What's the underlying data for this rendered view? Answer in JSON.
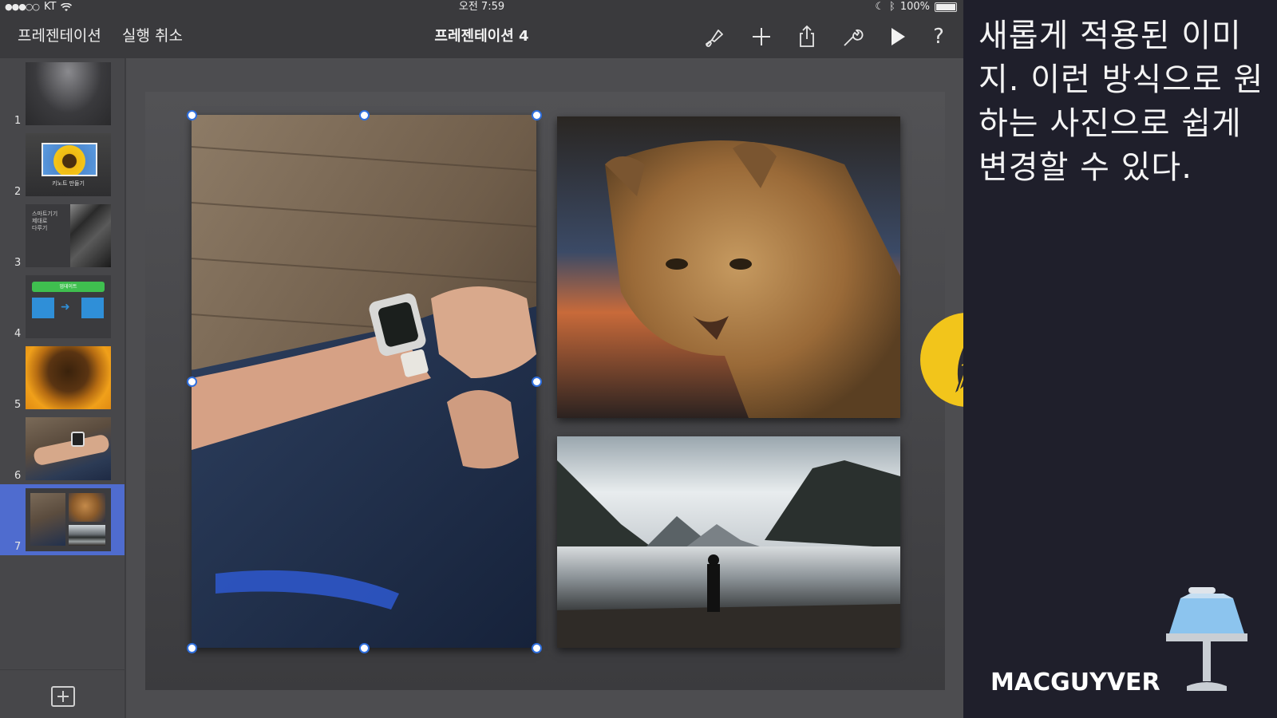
{
  "status_bar": {
    "carrier": "KT",
    "time": "오전 7:59",
    "battery": "100%"
  },
  "toolbar": {
    "presentations_label": "프레젠테이션",
    "undo_label": "실행 취소",
    "document_title": "프레젠테이션 4",
    "icons": [
      "paintbrush-icon",
      "plus-icon",
      "share-icon",
      "wrench-icon",
      "play-icon",
      "help-icon"
    ],
    "help_glyph": "?"
  },
  "sidebar": {
    "slides": [
      {
        "number": "1",
        "kind": "gradient"
      },
      {
        "number": "2",
        "kind": "sunflower-title",
        "text": "키노트 만들기"
      },
      {
        "number": "3",
        "kind": "text-and-laptop",
        "lines": [
          "스마트기기",
          "제대로",
          "다루기"
        ]
      },
      {
        "number": "4",
        "kind": "diagram",
        "text": "업데이트"
      },
      {
        "number": "5",
        "kind": "sunflower-closeup"
      },
      {
        "number": "6",
        "kind": "watch-photo"
      },
      {
        "number": "7",
        "kind": "collage",
        "selected": true
      }
    ]
  },
  "overlay_panel": {
    "caption": "새롭게 적용된 이미지. 이런 방식으로 원하는 사진으로 쉽게 변경할 수 있다.",
    "brand": "MACGUYVER"
  },
  "colors": {
    "selection_blue": "#4f6ccf",
    "handle_blue": "#2f6fde",
    "badge_yellow": "#f2c51b",
    "panel_bg": "#1f1f2b",
    "toolbar_bg": "#3a3a3d"
  }
}
